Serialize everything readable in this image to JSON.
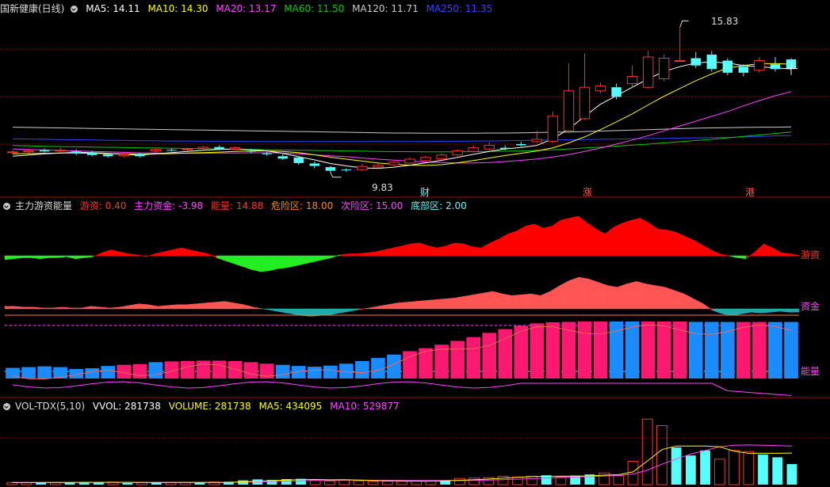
{
  "colors": {
    "up": "#ff3030",
    "down": "#54ffff",
    "ma5": "#ffffff",
    "ma10": "#ffff00",
    "ma20": "#ff44ff",
    "ma60": "#00cc00",
    "ma120": "#cccccc",
    "ma250": "#3344ff",
    "grid": "#b00000",
    "pink": "#ff1870",
    "blue": "#1a8cff",
    "youzi_pos": "#ff0000",
    "youzi_neg": "#22ee22",
    "zijin_pos": "#ff5555",
    "zijin_neg": "#22aaaa",
    "orange": "#ff8800",
    "vol_ma10": "#ff44ff"
  },
  "main": {
    "title": "国新健康(日线)",
    "ma": [
      {
        "label": "MA5: 14.11",
        "color": "#ffffff"
      },
      {
        "label": "MA10: 14.30",
        "color": "#ffff00"
      },
      {
        "label": "MA20: 13.17",
        "color": "#ff44ff"
      },
      {
        "label": "MA60: 11.50",
        "color": "#00cc00"
      },
      {
        "label": "MA120: 11.71",
        "color": "#cccccc"
      },
      {
        "label": "MA250: 11.35",
        "color": "#3344ff"
      }
    ],
    "high_label": "15.83",
    "low_label": "9.83",
    "markers": [
      "财",
      "涨",
      "港"
    ]
  },
  "ind": {
    "title": "主力游资能量",
    "items": [
      {
        "label": "游资: 0.40",
        "color": "#ff3030"
      },
      {
        "label": "主力资金: -3.98",
        "color": "#ff44ff"
      },
      {
        "label": "能量: 14.88",
        "color": "#ff3030"
      },
      {
        "label": "危险区: 18.00",
        "color": "#ff8800"
      },
      {
        "label": "次险区: 15.00",
        "color": "#ff44ff"
      },
      {
        "label": "底部区: 2.00",
        "color": "#54ffff"
      }
    ],
    "right_labels": {
      "youzi": "游资",
      "zijin": "资金",
      "nengliang": "能量"
    }
  },
  "vol": {
    "title": "VOL-TDX(5,10)",
    "items": [
      {
        "label": "VVOL: 281738",
        "color": "#ffffff"
      },
      {
        "label": "VOLUME: 281738",
        "color": "#ffff00"
      },
      {
        "label": "MA5: 434095",
        "color": "#ffff00"
      },
      {
        "label": "MA10: 529877",
        "color": "#ff44ff"
      }
    ]
  },
  "chart_data": [
    {
      "type": "candlestick",
      "name": "国新健康(日线)",
      "ylim": [
        9.3,
        16.3
      ],
      "x": [
        "1",
        "2",
        "3",
        "4",
        "5",
        "6",
        "7",
        "8",
        "9",
        "10",
        "11",
        "12",
        "13",
        "14",
        "15",
        "16",
        "17",
        "18",
        "19",
        "20",
        "21",
        "22",
        "23",
        "24",
        "25",
        "26",
        "27",
        "28",
        "29",
        "30",
        "31",
        "32",
        "33",
        "34",
        "35",
        "36",
        "37",
        "38",
        "39",
        "40",
        "41",
        "42",
        "43",
        "44",
        "45",
        "46",
        "47",
        "48",
        "49",
        "50"
      ],
      "open": [
        10.65,
        10.68,
        10.75,
        10.72,
        10.7,
        10.65,
        10.58,
        10.52,
        10.6,
        10.72,
        10.76,
        10.78,
        10.82,
        10.88,
        10.8,
        10.72,
        10.62,
        10.5,
        10.45,
        10.2,
        10.05,
        9.95,
        9.95,
        10.05,
        10.15,
        10.22,
        10.32,
        10.4,
        10.55,
        10.7,
        10.8,
        10.85,
        11.0,
        11.1,
        11.12,
        11.55,
        12.05,
        13.2,
        13.35,
        13.5,
        13.35,
        13.7,
        14.45,
        14.55,
        14.7,
        14.45,
        14.2,
        14.05,
        14.3,
        14.5
      ],
      "close": [
        10.68,
        10.72,
        10.7,
        10.75,
        10.62,
        10.55,
        10.5,
        10.58,
        10.5,
        10.78,
        10.75,
        10.8,
        10.87,
        10.8,
        10.85,
        10.7,
        10.6,
        10.4,
        10.22,
        10.1,
        9.9,
        9.92,
        10.08,
        10.12,
        10.25,
        10.38,
        10.45,
        10.55,
        10.72,
        10.85,
        10.95,
        10.8,
        10.95,
        11.2,
        12.15,
        13.2,
        13.35,
        13.4,
        12.95,
        13.8,
        14.6,
        14.55,
        14.45,
        14.25,
        14.1,
        13.95,
        13.95,
        14.45,
        14.1,
        14.12
      ],
      "high": [
        10.75,
        10.8,
        10.82,
        10.85,
        10.78,
        10.72,
        10.62,
        10.65,
        10.65,
        10.85,
        10.82,
        10.85,
        10.92,
        10.95,
        10.9,
        10.8,
        10.68,
        10.58,
        10.5,
        10.28,
        10.1,
        10.0,
        10.2,
        10.2,
        10.3,
        10.45,
        10.52,
        10.62,
        10.8,
        10.95,
        11.08,
        10.95,
        11.1,
        11.55,
        12.35,
        14.35,
        14.75,
        13.55,
        13.5,
        14.25,
        14.85,
        14.7,
        15.83,
        14.8,
        14.85,
        14.55,
        14.3,
        14.6,
        14.6,
        14.55
      ],
      "low": [
        10.6,
        10.62,
        10.65,
        10.65,
        10.55,
        10.5,
        10.45,
        10.45,
        10.45,
        10.65,
        10.7,
        10.72,
        10.78,
        10.75,
        10.75,
        10.62,
        10.52,
        10.35,
        10.15,
        10.0,
        9.83,
        9.85,
        9.9,
        10.0,
        10.1,
        10.18,
        10.28,
        10.35,
        10.5,
        10.65,
        10.75,
        10.75,
        10.9,
        11.05,
        11.05,
        11.45,
        12.0,
        13.1,
        12.85,
        13.35,
        13.3,
        13.6,
        14.4,
        14.15,
        14.0,
        13.85,
        13.8,
        13.95,
        14.0,
        14.05
      ],
      "ma5": [
        10.5,
        10.55,
        10.6,
        10.63,
        10.66,
        10.65,
        10.62,
        10.58,
        10.55,
        10.6,
        10.65,
        10.7,
        10.75,
        10.78,
        10.8,
        10.77,
        10.72,
        10.62,
        10.48,
        10.35,
        10.2,
        10.1,
        10.02,
        10.0,
        10.05,
        10.13,
        10.23,
        10.33,
        10.45,
        10.58,
        10.7,
        10.8,
        10.86,
        10.95,
        11.22,
        11.62,
        12.15,
        12.65,
        13.0,
        13.35,
        13.7,
        14.0,
        14.2,
        14.35,
        14.4,
        14.35,
        14.25,
        14.2,
        14.15,
        14.11
      ],
      "ma10": [
        10.6,
        10.61,
        10.62,
        10.63,
        10.63,
        10.62,
        10.61,
        10.6,
        10.59,
        10.6,
        10.61,
        10.63,
        10.65,
        10.67,
        10.7,
        10.72,
        10.72,
        10.7,
        10.65,
        10.56,
        10.46,
        10.38,
        10.3,
        10.22,
        10.17,
        10.13,
        10.12,
        10.15,
        10.23,
        10.32,
        10.43,
        10.53,
        10.62,
        10.72,
        10.85,
        11.05,
        11.3,
        11.6,
        11.92,
        12.25,
        12.62,
        12.98,
        13.3,
        13.62,
        13.9,
        14.15,
        14.25,
        14.32,
        14.33,
        14.3
      ],
      "ma20": [
        10.8,
        10.78,
        10.76,
        10.74,
        10.72,
        10.7,
        10.68,
        10.66,
        10.64,
        10.63,
        10.62,
        10.62,
        10.62,
        10.63,
        10.63,
        10.64,
        10.64,
        10.63,
        10.6,
        10.56,
        10.52,
        10.48,
        10.43,
        10.38,
        10.34,
        10.3,
        10.26,
        10.24,
        10.22,
        10.22,
        10.24,
        10.28,
        10.33,
        10.39,
        10.47,
        10.57,
        10.7,
        10.84,
        11.0,
        11.17,
        11.35,
        11.55,
        11.75,
        11.95,
        12.15,
        12.35,
        12.58,
        12.8,
        13.0,
        13.17
      ],
      "ma60": [
        10.95,
        10.93,
        10.91,
        10.9,
        10.89,
        10.88,
        10.87,
        10.86,
        10.85,
        10.84,
        10.83,
        10.82,
        10.81,
        10.8,
        10.79,
        10.78,
        10.77,
        10.76,
        10.75,
        10.74,
        10.73,
        10.72,
        10.71,
        10.7,
        10.69,
        10.69,
        10.68,
        10.68,
        10.68,
        10.69,
        10.7,
        10.71,
        10.72,
        10.74,
        10.77,
        10.8,
        10.84,
        10.88,
        10.92,
        10.96,
        11.0,
        11.05,
        11.1,
        11.15,
        11.2,
        11.26,
        11.32,
        11.38,
        11.44,
        11.5
      ],
      "ma120": [
        11.7,
        11.69,
        11.68,
        11.67,
        11.66,
        11.65,
        11.64,
        11.63,
        11.62,
        11.61,
        11.6,
        11.59,
        11.58,
        11.57,
        11.56,
        11.55,
        11.54,
        11.53,
        11.52,
        11.51,
        11.5,
        11.49,
        11.48,
        11.47,
        11.46,
        11.46,
        11.45,
        11.45,
        11.45,
        11.45,
        11.46,
        11.46,
        11.47,
        11.48,
        11.49,
        11.5,
        11.52,
        11.54,
        11.56,
        11.58,
        11.6,
        11.62,
        11.64,
        11.66,
        11.67,
        11.68,
        11.69,
        11.7,
        11.7,
        11.71
      ],
      "ma250": [
        11.22,
        11.21,
        11.2,
        11.19,
        11.18,
        11.17,
        11.16,
        11.15,
        11.14,
        11.14,
        11.13,
        11.13,
        11.12,
        11.12,
        11.12,
        11.11,
        11.11,
        11.11,
        11.11,
        11.11,
        11.11,
        11.11,
        11.11,
        11.11,
        11.11,
        11.11,
        11.11,
        11.12,
        11.12,
        11.13,
        11.13,
        11.14,
        11.15,
        11.16,
        11.17,
        11.18,
        11.19,
        11.2,
        11.21,
        11.22,
        11.23,
        11.24,
        11.25,
        11.26,
        11.27,
        11.28,
        11.3,
        11.32,
        11.34,
        11.35
      ]
    },
    {
      "type": "area",
      "name": "主力游资能量",
      "youzi": [
        -4,
        -3,
        -2,
        -2,
        -3,
        -2,
        -2,
        -1,
        -3,
        -2,
        -1,
        3,
        6,
        4,
        2,
        1,
        -1,
        2,
        4,
        6,
        8,
        6,
        4,
        2,
        -2,
        -5,
        -8,
        -11,
        -14,
        -16,
        -15,
        -13,
        -12,
        -10,
        -8,
        -6,
        -4,
        -2,
        1,
        2,
        2,
        3,
        4,
        6,
        8,
        10,
        12,
        13,
        10,
        8,
        10,
        13,
        12,
        9,
        8,
        13,
        17,
        22,
        25,
        30,
        32,
        28,
        30,
        36,
        38,
        40,
        33,
        27,
        22,
        29,
        33,
        36,
        38,
        33,
        27,
        26,
        24,
        20,
        16,
        11,
        6,
        2,
        0,
        -2,
        -3,
        4,
        12,
        8,
        3,
        2,
        0.4
      ],
      "zijin": [
        3,
        3,
        2,
        2,
        1,
        1,
        2,
        1,
        1,
        3,
        2,
        1,
        2,
        4,
        6,
        5,
        3,
        4,
        5,
        5,
        6,
        7,
        8,
        9,
        7,
        5,
        2,
        0,
        -2,
        -4,
        -6,
        -8,
        -9,
        -8,
        -7,
        -5,
        -3,
        -1,
        1,
        3,
        5,
        7,
        8,
        9,
        10,
        11,
        12,
        13,
        15,
        17,
        19,
        21,
        18,
        16,
        17,
        18,
        16,
        21,
        28,
        34,
        38,
        36,
        32,
        28,
        26,
        30,
        33,
        30,
        28,
        26,
        22,
        18,
        12,
        6,
        -2,
        -6,
        -8,
        -6,
        -4,
        -5,
        -4,
        -3,
        -4,
        -3.98
      ],
      "nengliang": [
        3,
        3,
        3,
        2,
        3,
        2,
        3,
        3,
        2,
        3,
        4,
        5,
        5,
        5,
        6,
        6,
        6,
        6,
        6,
        5,
        5,
        5,
        5,
        4,
        4,
        4,
        3,
        3,
        3,
        3,
        2,
        2,
        2,
        2,
        3,
        3,
        4,
        4,
        4,
        5,
        6,
        6,
        6,
        6,
        6,
        5,
        4,
        3,
        3,
        2,
        2,
        2,
        2,
        2,
        3,
        3,
        3,
        3,
        4,
        4,
        4,
        4,
        5,
        5,
        6,
        6,
        6,
        6,
        6,
        6,
        6,
        6,
        6,
        5,
        4,
        4,
        3,
        3,
        3,
        3,
        3,
        3,
        3,
        3,
        3,
        3,
        3,
        3,
        3,
        2.5,
        2.5
      ],
      "energy": [
        2.8,
        3.0,
        3.2,
        3.0,
        2.5,
        2.7,
        3.3,
        3.6,
        3.8,
        4.3,
        4.5,
        4.6,
        4.7,
        4.7,
        4.6,
        4.3,
        3.9,
        3.6,
        3.3,
        3.1,
        3.4,
        3.9,
        4.6,
        5.4,
        6.3,
        7.2,
        8.0,
        8.9,
        9.9,
        10.9,
        12.0,
        13.0,
        13.9,
        14.5,
        14.8,
        14.9,
        15.0,
        15.0,
        15.0,
        15.0,
        15.0,
        15.0,
        15.0,
        14.9,
        14.9,
        14.88,
        14.88,
        14.88,
        14.88,
        14.88
      ],
      "energy_color": [
        "b",
        "b",
        "b",
        "b",
        "b",
        "b",
        "b",
        "p",
        "p",
        "b",
        "p",
        "p",
        "p",
        "p",
        "p",
        "p",
        "p",
        "b",
        "b",
        "b",
        "b",
        "b",
        "b",
        "b",
        "b",
        "p",
        "p",
        "p",
        "p",
        "p",
        "p",
        "p",
        "p",
        "p",
        "p",
        "p",
        "p",
        "p",
        "b",
        "b",
        "p",
        "p",
        "p",
        "b",
        "b",
        "b",
        "p",
        "p",
        "b",
        "b"
      ],
      "danger": 18,
      "sub_danger": 15,
      "bottom": 2
    },
    {
      "type": "bar",
      "name": "VOL-TDX(5,10)",
      "ylim": [
        0,
        1000000
      ],
      "volume": [
        29000,
        26000,
        30000,
        27000,
        33000,
        34000,
        29000,
        35000,
        23000,
        28000,
        28000,
        30000,
        30000,
        26000,
        36000,
        40000,
        58000,
        72000,
        64000,
        76000,
        80000,
        62000,
        50000,
        66000,
        52000,
        44000,
        48000,
        46000,
        50000,
        54000,
        58000,
        84000,
        90000,
        96000,
        115000,
        102000,
        115000,
        128000,
        108000,
        125000,
        140000,
        160000,
        125000,
        320000,
        900000,
        810000,
        510000,
        400000,
        470000,
        350000,
        470000,
        455000,
        412000,
        375000,
        281738
      ],
      "up": [
        true,
        true,
        false,
        true,
        false,
        false,
        false,
        true,
        false,
        true,
        false,
        true,
        true,
        false,
        true,
        false,
        false,
        false,
        false,
        false,
        false,
        true,
        true,
        true,
        true,
        true,
        true,
        true,
        true,
        true,
        false,
        true,
        true,
        true,
        true,
        true,
        true,
        false,
        true,
        false,
        false,
        true,
        true,
        true,
        true,
        true,
        false,
        false,
        false,
        true,
        true,
        true,
        false,
        false,
        false
      ],
      "ma5": [
        28000,
        28000,
        28500,
        29000,
        30000,
        31000,
        31500,
        32000,
        31000,
        29000,
        28500,
        29000,
        29000,
        29000,
        30000,
        32000,
        38000,
        46000,
        54000,
        62000,
        70000,
        71000,
        66000,
        67000,
        63000,
        55000,
        52000,
        51000,
        48000,
        48000,
        51000,
        59000,
        67000,
        76000,
        88000,
        101000,
        110000,
        115000,
        115000,
        116000,
        120000,
        130000,
        136000,
        175000,
        325000,
        480000,
        530000,
        530000,
        530000,
        520000,
        460000,
        430000,
        430000,
        430000,
        434095
      ],
      "ma10": [
        30000,
        30000,
        30000,
        30000,
        30000,
        30500,
        30500,
        31000,
        31000,
        31000,
        31000,
        31000,
        31000,
        31000,
        31500,
        32000,
        35000,
        39000,
        43000,
        47000,
        52000,
        56000,
        58000,
        61000,
        62000,
        60000,
        59000,
        58000,
        56000,
        55000,
        56000,
        58000,
        60000,
        63000,
        68000,
        75000,
        82000,
        90000,
        98000,
        104000,
        110000,
        118000,
        125000,
        145000,
        200000,
        280000,
        350000,
        420000,
        470000,
        520000,
        540000,
        545000,
        540000,
        535000,
        529877
      ]
    }
  ]
}
